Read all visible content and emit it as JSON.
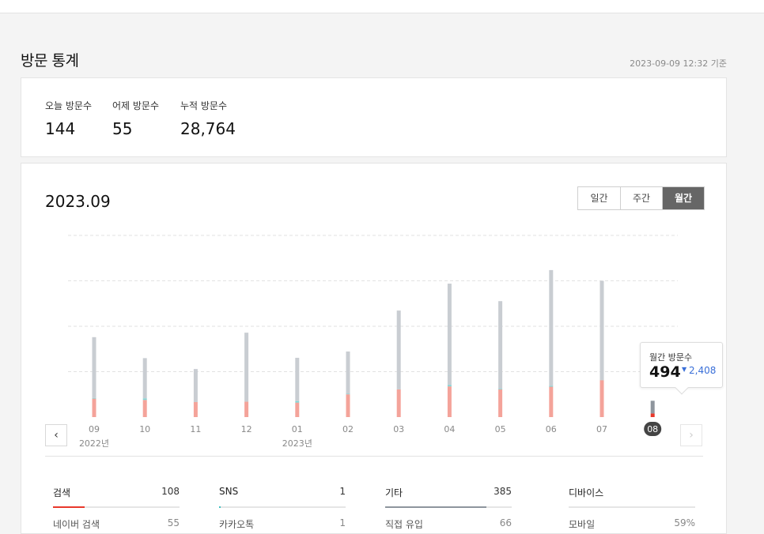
{
  "page": {
    "title": "방문 통계",
    "timestamp": "2023-09-09 12:32 기준"
  },
  "summary": [
    {
      "label": "오늘 방문수",
      "value": "144"
    },
    {
      "label": "어제 방문수",
      "value": "55"
    },
    {
      "label": "누적 방문수",
      "value": "28,764"
    }
  ],
  "period": {
    "title": "2023.09"
  },
  "tabs": [
    {
      "label": "일간",
      "active": false
    },
    {
      "label": "주간",
      "active": false
    },
    {
      "label": "월간",
      "active": true
    }
  ],
  "nav": {
    "prev": "‹",
    "next": "›"
  },
  "colors": {
    "total": "#c9cdd2",
    "search": "#f4a39a",
    "sns": "#7fd8d8",
    "selected": "#8e959d",
    "selected_search": "#e8382b",
    "selected_label_bg": "#444444"
  },
  "chart_data": {
    "type": "bar",
    "categories": [
      "09",
      "10",
      "11",
      "12",
      "01",
      "02",
      "03",
      "04",
      "05",
      "06",
      "07",
      "08"
    ],
    "year_labels": [
      {
        "index": 0,
        "label": "2022년"
      },
      {
        "index": 4,
        "label": "2023년"
      }
    ],
    "series": [
      {
        "name": "검색",
        "values": [
          560,
          520,
          460,
          470,
          440,
          690,
          840,
          930,
          840,
          920,
          1120,
          108
        ]
      },
      {
        "name": "SNS",
        "values": [
          20,
          45,
          5,
          5,
          45,
          15,
          5,
          40,
          20,
          30,
          5,
          1
        ]
      },
      {
        "name": "기타",
        "values": [
          1840,
          1220,
          990,
          2080,
          1310,
          1280,
          2380,
          3070,
          2650,
          3500,
          3000,
          385
        ]
      }
    ],
    "totals": [
      2420,
      1785,
      1455,
      2555,
      1795,
      1985,
      3225,
      4040,
      3510,
      4450,
      4125,
      494
    ],
    "selected_index": 11,
    "ylim": [
      0,
      5500
    ],
    "grid": true,
    "tooltip": {
      "label": "월간 방문수",
      "value": "494",
      "diff": "2,408"
    }
  },
  "categories": [
    {
      "title": "검색",
      "total": "108",
      "fill": 0.25,
      "color": "#e8382b",
      "rows": [
        {
          "label": "네이버 검색",
          "value": "55"
        }
      ]
    },
    {
      "title": "SNS",
      "total": "1",
      "fill": 0.01,
      "color": "#3fc1c1",
      "rows": [
        {
          "label": "카카오톡",
          "value": "1"
        }
      ]
    },
    {
      "title": "기타",
      "total": "385",
      "fill": 0.8,
      "color": "#8e959d",
      "rows": [
        {
          "label": "직접 유입",
          "value": "66"
        }
      ]
    },
    {
      "title": "디바이스",
      "total": "",
      "fill": 0,
      "color": "#8e959d",
      "rows": [
        {
          "label": "모바일",
          "value": "59%"
        }
      ]
    }
  ]
}
